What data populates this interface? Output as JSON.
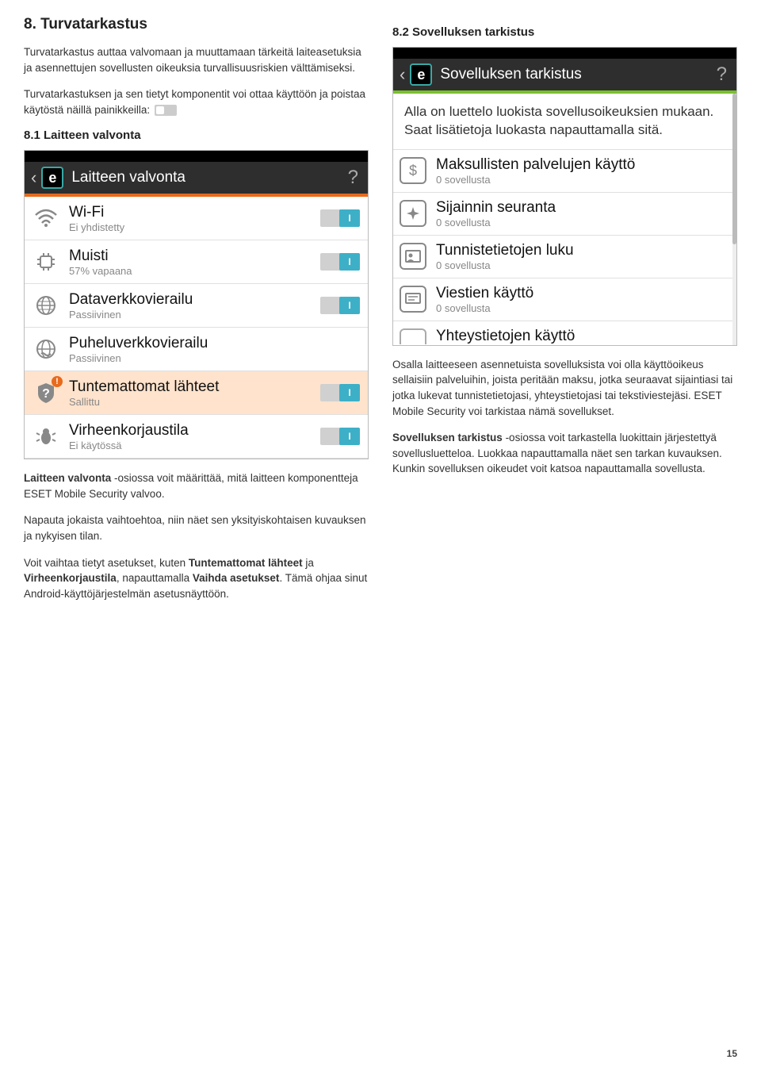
{
  "left": {
    "h2": "8. Turvatarkastus",
    "p1": "Turvatarkastus auttaa valvomaan ja muuttamaan tärkeitä laiteasetuksia ja asennettujen sovellusten oikeuksia turvallisuusriskien välttämiseksi.",
    "p2": "Turvatarkastuksen ja sen tietyt komponentit voi ottaa käyttöön ja poistaa käytöstä näillä painikkeilla:",
    "h3": "8.1   Laitteen valvonta",
    "screenshot": {
      "header_title": "Laitteen valvonta",
      "items": [
        {
          "icon": "wifi",
          "title": "Wi-Fi",
          "sub": "Ei yhdistetty",
          "toggle": true
        },
        {
          "icon": "chip",
          "title": "Muisti",
          "sub": "57% vapaana",
          "toggle": true
        },
        {
          "icon": "globe",
          "title": "Dataverkkovierailu",
          "sub": "Passiivinen",
          "toggle": true
        },
        {
          "icon": "globe-phone",
          "title": "Puheluverkkovierailu",
          "sub": "Passiivinen",
          "toggle": false
        },
        {
          "icon": "unknown",
          "title": "Tuntemattomat lähteet",
          "sub": "Sallittu",
          "toggle": true,
          "highlight": true,
          "warn": true
        },
        {
          "icon": "bug",
          "title": "Virheenkorjaustila",
          "sub": "Ei käytössä",
          "toggle": true
        }
      ]
    },
    "p3_prefix": "Laitteen valvonta",
    "p3": " -osiossa voit määrittää, mitä laitteen komponentteja ESET Mobile Security valvoo.",
    "p4": "Napauta jokaista vaihtoehtoa, niin näet sen yksityiskohtaisen kuvauksen ja nykyisen tilan.",
    "p5a": "Voit vaihtaa tietyt asetukset, kuten ",
    "p5b": "Tuntemattomat lähteet",
    "p5c": " ja ",
    "p5d": "Virheenkorjaustila",
    "p5e": ", napauttamalla ",
    "p5f": "Vaihda asetukset",
    "p5g": ". Tämä ohjaa sinut Android-käyttöjärjestelmän asetusnäyttöön."
  },
  "right": {
    "h3": "8.2   Sovelluksen tarkistus",
    "screenshot": {
      "header_title": "Sovelluksen tarkistus",
      "intro": "Alla on luettelo luokista sovellusoikeuksien mukaan. Saat lisätietoja luokasta napauttamalla sitä.",
      "items": [
        {
          "icon": "dollar",
          "title": "Maksullisten palvelujen käyttö",
          "sub": "0 sovellusta"
        },
        {
          "icon": "location",
          "title": "Sijainnin seuranta",
          "sub": "0 sovellusta"
        },
        {
          "icon": "id",
          "title": "Tunnistetietojen luku",
          "sub": "0 sovellusta"
        },
        {
          "icon": "message",
          "title": "Viestien käyttö",
          "sub": "0 sovellusta"
        }
      ],
      "cutoff_title": "Yhteystietojen käyttö"
    },
    "p1": "Osalla laitteeseen asennetuista sovelluksista voi olla käyttöoikeus sellaisiin palveluihin, joista peritään maksu, jotka seuraavat sijaintiasi tai jotka lukevat tunnistetietojasi, yhteystietojasi tai tekstiviestejäsi. ESET Mobile Security voi tarkistaa nämä sovellukset.",
    "p2_prefix": "Sovelluksen tarkistus",
    "p2": " -osiossa voit tarkastella luokittain järjestettyä sovellusluetteloa. Luokkaa napauttamalla näet sen tarkan kuvauksen. Kunkin sovelluksen oikeudet voit katsoa napauttamalla sovellusta."
  },
  "page_number": "15"
}
